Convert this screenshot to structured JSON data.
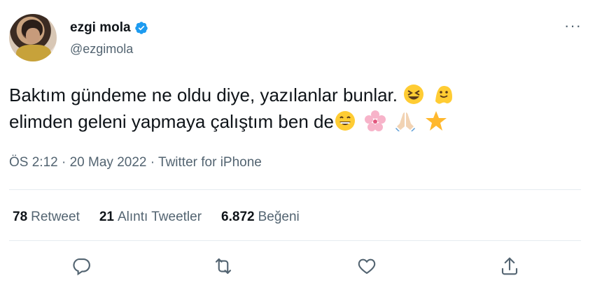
{
  "author": {
    "display_name": "ezgi mola",
    "handle": "@ezgimola",
    "verified": true
  },
  "tweet": {
    "line1": "Baktım gündeme ne oldu diye, yazılanlar bunlar.",
    "line2": "elimden geleni yapmaya çalıştım ben de",
    "emojis_line1": [
      "squinting-laugh-emoji",
      "melting-face-emoji"
    ],
    "emojis_line2": [
      "grinning-emoji",
      "cherry-blossom-emoji",
      "folded-hands-emoji",
      "star-emoji"
    ]
  },
  "meta": {
    "time": "ÖS 2:12",
    "sep1": "·",
    "date": "20 May 2022",
    "sep2": "·",
    "source": "Twitter for iPhone"
  },
  "stats": {
    "retweets_count": "78",
    "retweets_label": "Retweet",
    "quotes_count": "21",
    "quotes_label": "Alıntı Tweetler",
    "likes_count": "6.872",
    "likes_label": "Beğeni"
  },
  "colors": {
    "text": "#0f1419",
    "secondary": "#536471",
    "verified": "#1d9bf0",
    "divider": "#e6ecf0"
  },
  "icons": {
    "more": "more-icon",
    "reply": "reply-icon",
    "retweet": "retweet-icon",
    "like": "like-icon",
    "share": "share-icon"
  }
}
